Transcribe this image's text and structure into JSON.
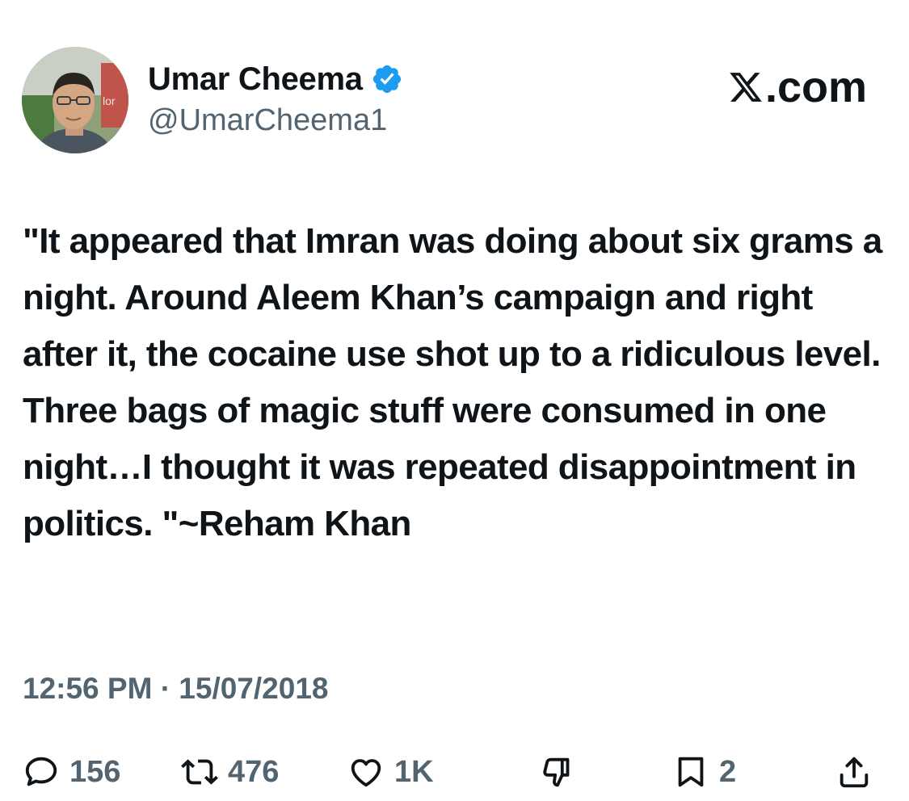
{
  "author": {
    "display_name": "Umar Cheema",
    "handle": "@UmarCheema1",
    "verified_icon": "verified-badge-icon",
    "avatar_sign_text": "lor"
  },
  "brand": {
    "text": ".com",
    "icon": "x-logo-icon"
  },
  "tweet": {
    "text": "\"It appeared that Imran was doing about six grams a night. Around Aleem Khan’s campaign and right after it, the cocaine use shot up to a ridiculous level. Three bags of magic stuff were consumed in one night…I thought it was repeated disappointment in politics. \"~Reham Khan",
    "timestamp": "12:56 PM · 15/07/2018"
  },
  "actions": {
    "reply": {
      "icon": "reply-icon",
      "count": "156"
    },
    "retweet": {
      "icon": "retweet-icon",
      "count": "476"
    },
    "like": {
      "icon": "heart-icon",
      "count": "1K"
    },
    "downvote": {
      "icon": "downvote-icon"
    },
    "bookmark": {
      "icon": "bookmark-icon",
      "count": "2"
    },
    "share": {
      "icon": "share-icon"
    }
  },
  "colors": {
    "text": "#0f1419",
    "secondary": "#536471",
    "verified": "#1d9bf0",
    "background": "#ffffff"
  }
}
